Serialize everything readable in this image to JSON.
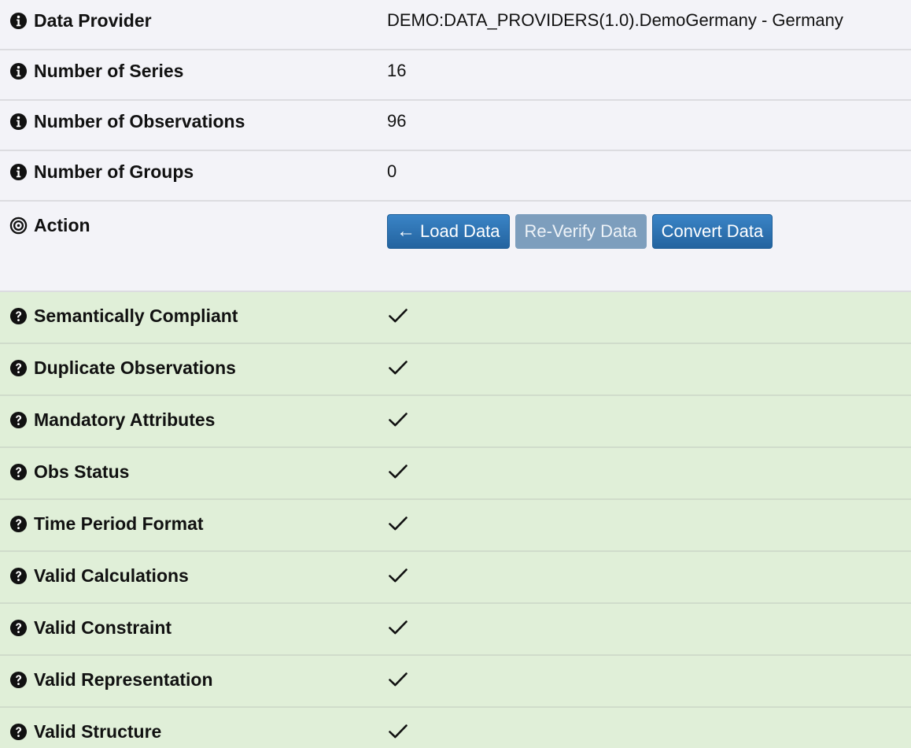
{
  "info_rows": [
    {
      "label": "Data Provider",
      "value": "DEMO:DATA_PROVIDERS(1.0).DemoGermany - Germany",
      "icon": "info-circle-icon"
    },
    {
      "label": "Number of Series",
      "value": "16",
      "icon": "info-circle-icon"
    },
    {
      "label": "Number of Observations",
      "value": "96",
      "icon": "info-circle-icon"
    },
    {
      "label": "Number of Groups",
      "value": "0",
      "icon": "info-circle-icon"
    }
  ],
  "action": {
    "label": "Action",
    "icon": "target-icon",
    "buttons": [
      {
        "label": "Load Data",
        "icon": "arrow-left-icon",
        "enabled": true
      },
      {
        "label": "Re-Verify Data",
        "enabled": false
      },
      {
        "label": "Convert Data",
        "enabled": true
      }
    ]
  },
  "checks": [
    {
      "label": "Semantically Compliant",
      "status": "pass"
    },
    {
      "label": "Duplicate Observations",
      "status": "pass"
    },
    {
      "label": "Mandatory Attributes",
      "status": "pass"
    },
    {
      "label": "Obs Status",
      "status": "pass"
    },
    {
      "label": "Time Period Format",
      "status": "pass"
    },
    {
      "label": "Valid Calculations",
      "status": "pass"
    },
    {
      "label": "Valid Constraint",
      "status": "pass"
    },
    {
      "label": "Valid Representation",
      "status": "pass"
    },
    {
      "label": "Valid Structure",
      "status": "pass"
    }
  ],
  "colors": {
    "info_background": "#f3f3f8",
    "check_background": "#e0efd8",
    "button_primary": "#2a6fb0",
    "button_disabled": "#7d9ebd"
  }
}
